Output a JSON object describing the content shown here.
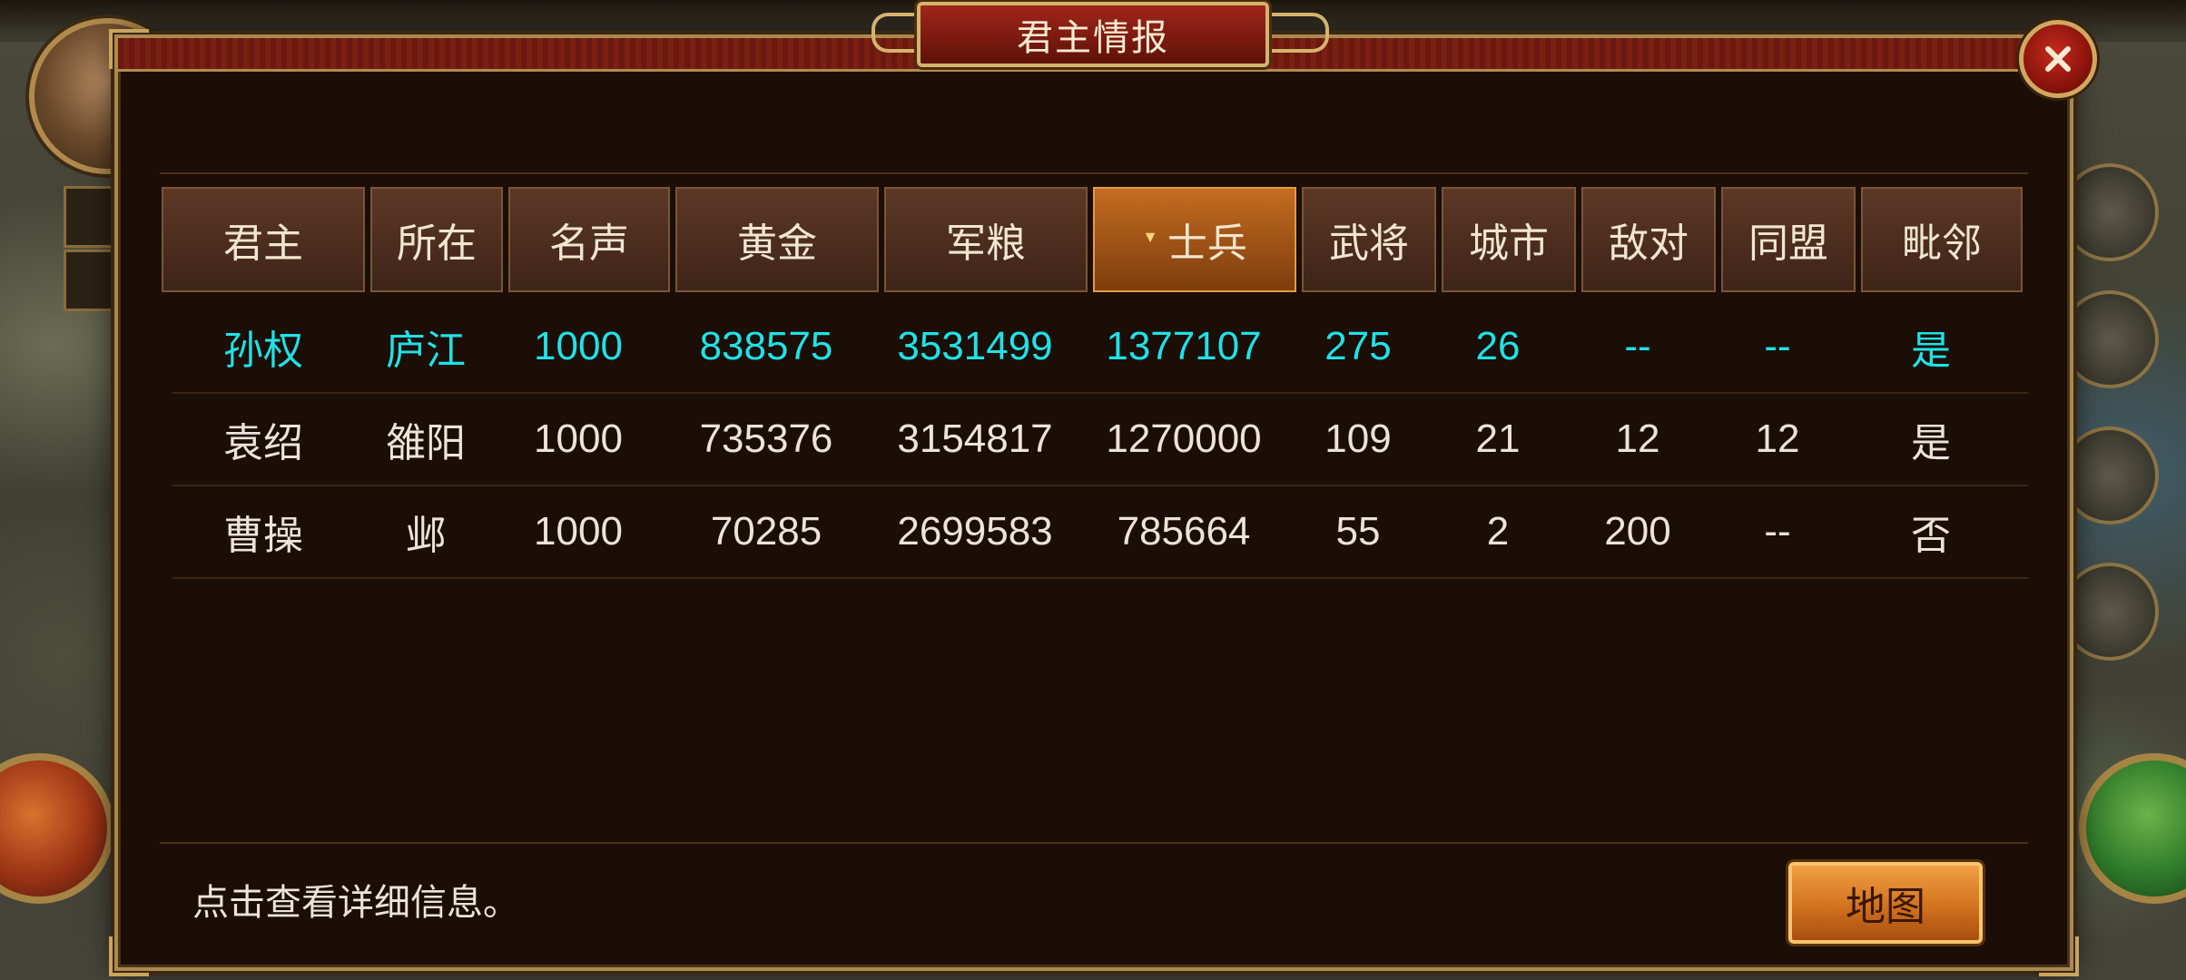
{
  "dialog": {
    "title": "君主情报",
    "footer_hint": "点击查看详细信息。",
    "map_button": "地图"
  },
  "table": {
    "headers": [
      "君主",
      "所在",
      "名声",
      "黄金",
      "军粮",
      "士兵",
      "武将",
      "城市",
      "敌对",
      "同盟",
      "毗邻"
    ],
    "sorted_column": "士兵",
    "rows": [
      [
        "孙权",
        "庐江",
        "1000",
        "838575",
        "3531499",
        "1377107",
        "275",
        "26",
        "--",
        "--",
        "是"
      ],
      [
        "袁绍",
        "雒阳",
        "1000",
        "735376",
        "3154817",
        "1270000",
        "109",
        "21",
        "12",
        "12",
        "是"
      ],
      [
        "曹操",
        "邺",
        "1000",
        "70285",
        "2699583",
        "785664",
        "55",
        "2",
        "200",
        "--",
        "否"
      ]
    ]
  },
  "colors": {
    "highlight_row": "#1fe2e6",
    "text": "#ece4d6",
    "active_header": "#c36d22"
  },
  "icons": {
    "close": "close-icon",
    "sort": "sort-down-icon"
  }
}
